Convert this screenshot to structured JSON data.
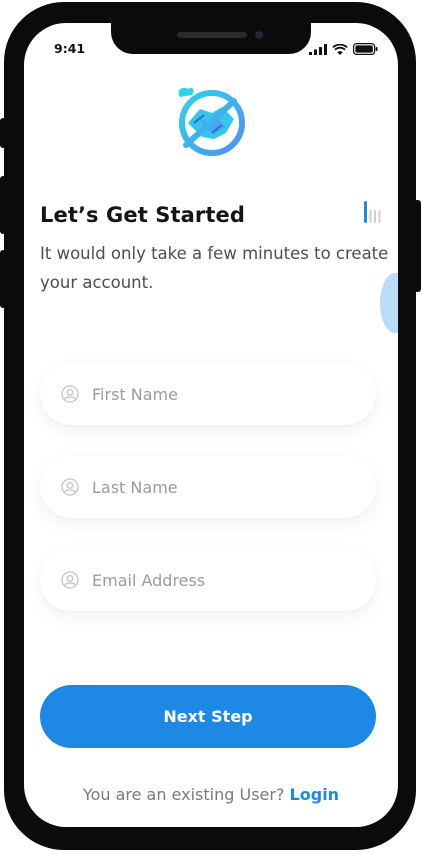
{
  "status": {
    "time": "9:41"
  },
  "header": {
    "title": "Let’s Get Started",
    "subtitle": "It would only take a few minutes to create your account."
  },
  "form": {
    "first_name": {
      "placeholder": "First Name",
      "value": ""
    },
    "last_name": {
      "placeholder": "Last Name",
      "value": ""
    },
    "email": {
      "placeholder": "Email Address",
      "value": ""
    }
  },
  "actions": {
    "next_label": "Next Step"
  },
  "footer": {
    "prompt": "You are an existing User?",
    "login_label": "Login"
  },
  "icons": {
    "logo": "handshake-logo-icon",
    "field": "user-outline-icon",
    "progress": "progress-steps-icon"
  },
  "colors": {
    "accent": "#1e88e5",
    "logo_teal": "#2ed3e6",
    "logo_blue": "#4f8ff7"
  }
}
